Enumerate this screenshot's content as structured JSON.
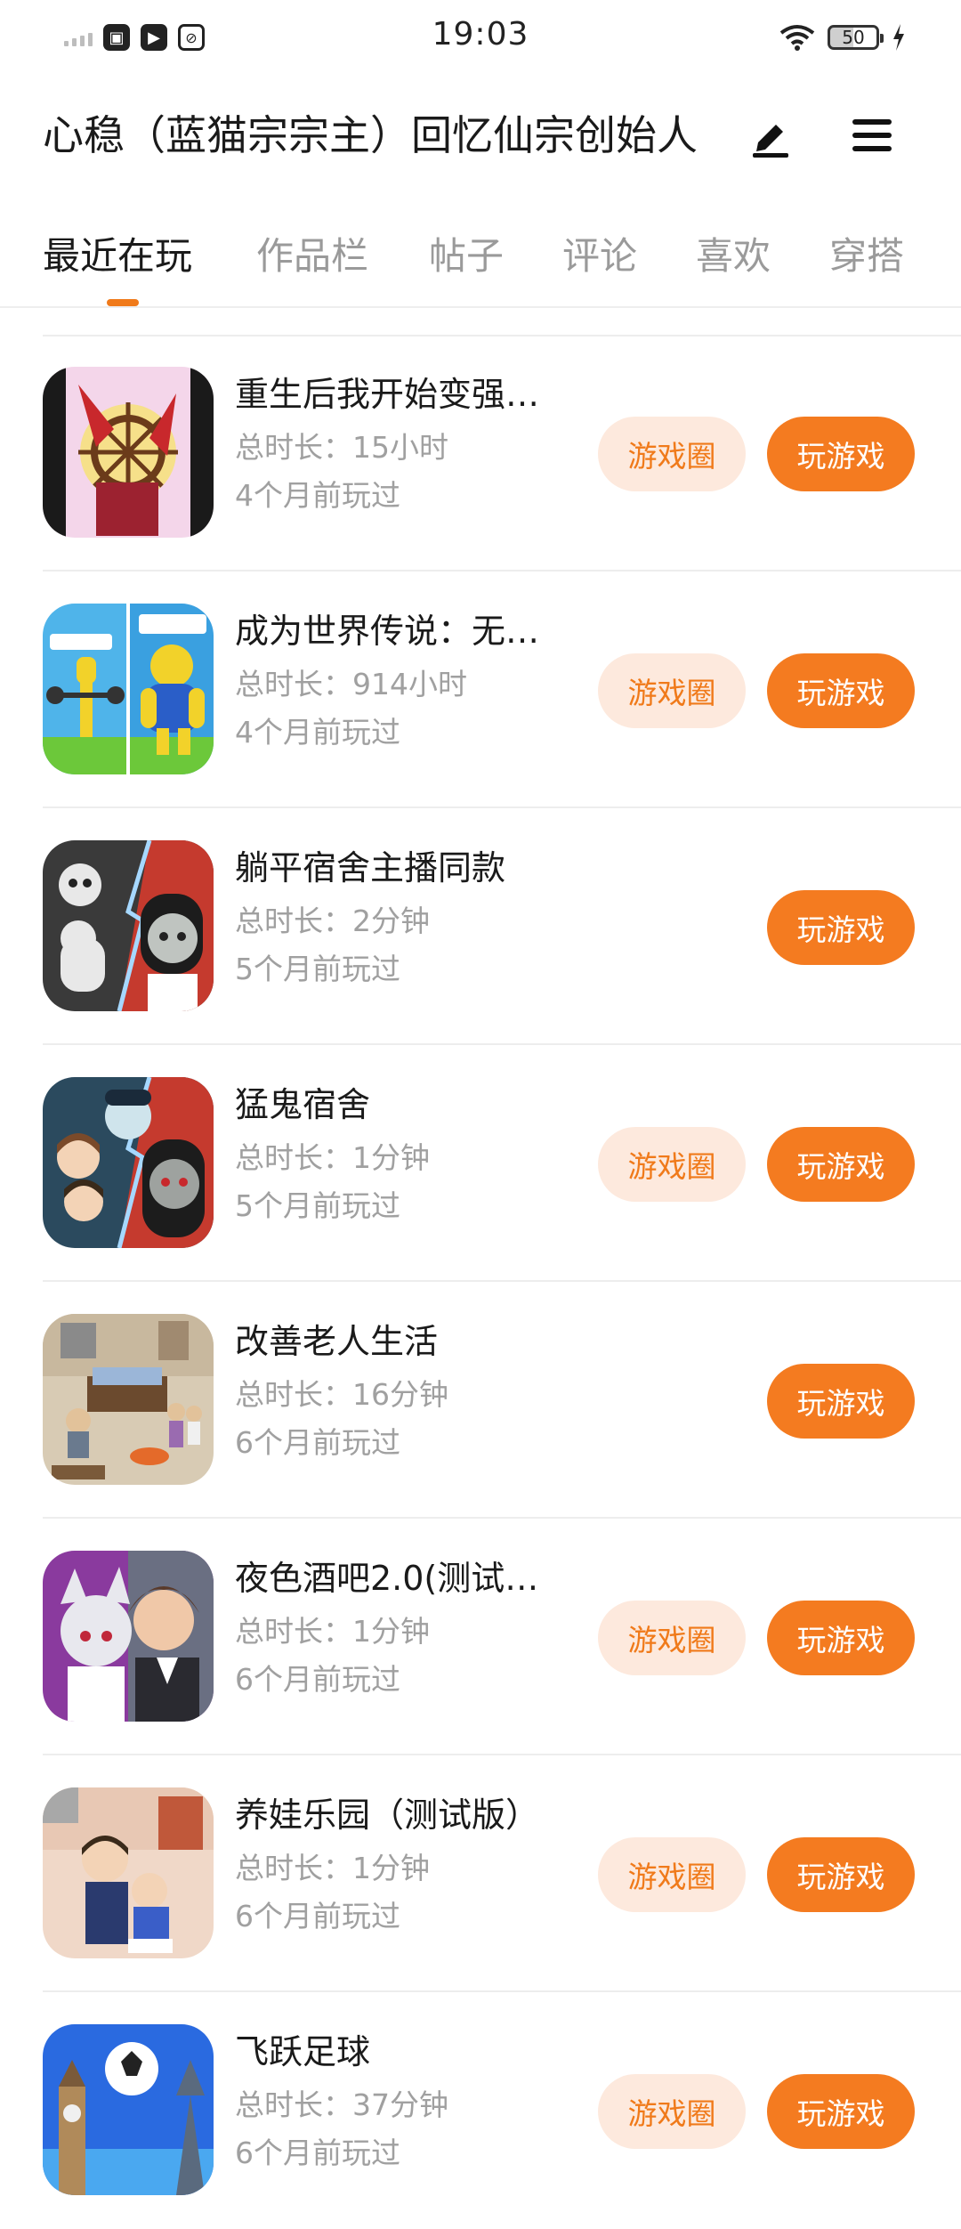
{
  "status_bar": {
    "time": "19:03",
    "battery": "50"
  },
  "header": {
    "title": "心稳（蓝猫宗宗主）回忆仙宗创始人"
  },
  "tabs": [
    "最近在玩",
    "作品栏",
    "帖子",
    "评论",
    "喜欢",
    "穿搭"
  ],
  "active_tab": "最近在玩",
  "buttons": {
    "circle": "游戏圈",
    "play": "玩游戏"
  },
  "games": [
    {
      "name": "重生后我开始变强…",
      "duration": "总时长：15小时",
      "last_played": "4个月前玩过",
      "has_circle": true
    },
    {
      "name": "成为世界传说：无…",
      "duration": "总时长：914小时",
      "last_played": "4个月前玩过",
      "has_circle": true
    },
    {
      "name": "躺平宿舍主播同款",
      "duration": "总时长：2分钟",
      "last_played": "5个月前玩过",
      "has_circle": false
    },
    {
      "name": "猛鬼宿舍",
      "duration": "总时长：1分钟",
      "last_played": "5个月前玩过",
      "has_circle": true
    },
    {
      "name": "改善老人生活",
      "duration": "总时长：16分钟",
      "last_played": "6个月前玩过",
      "has_circle": false
    },
    {
      "name": "夜色酒吧2.0(测试…",
      "duration": "总时长：1分钟",
      "last_played": "6个月前玩过",
      "has_circle": true
    },
    {
      "name": "养娃乐园（测试版）",
      "duration": "总时长：1分钟",
      "last_played": "6个月前玩过",
      "has_circle": true
    },
    {
      "name": "飞跃足球",
      "duration": "总时长：37分钟",
      "last_played": "6个月前玩过",
      "has_circle": true
    }
  ],
  "colors": {
    "accent": "#f47b20",
    "circle_bg": "#fde9dd",
    "circle_text": "#f07a1a",
    "muted_text": "#a0a0a0"
  }
}
